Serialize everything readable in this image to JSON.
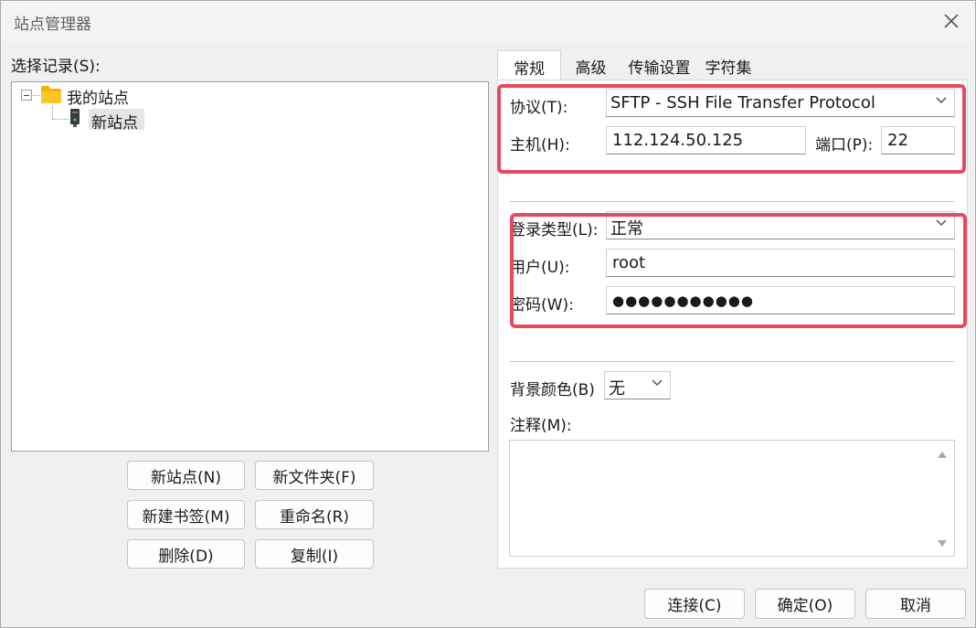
{
  "window": {
    "title": "站点管理器"
  },
  "left": {
    "records_label": "选择记录(S):",
    "tree": {
      "root": "我的站点",
      "child": "新站点"
    },
    "buttons": {
      "new_site": "新站点(N)",
      "new_folder": "新文件夹(F)",
      "new_bookmark": "新建书签(M)",
      "rename": "重命名(R)",
      "delete": "删除(D)",
      "copy": "复制(I)"
    }
  },
  "tabs": [
    "常规",
    "高级",
    "传输设置",
    "字符集"
  ],
  "general": {
    "protocol_label": "协议(T):",
    "protocol_value": "SFTP - SSH File Transfer Protocol",
    "host_label": "主机(H):",
    "host_value": "112.124.50.125",
    "port_label": "端口(P):",
    "port_value": "22",
    "logon_type_label": "登录类型(L):",
    "logon_type_value": "正常",
    "user_label": "用户(U):",
    "user_value": "root",
    "password_label": "密码(W):",
    "password_value": "●●●●●●●●●●●",
    "bg_color_label": "背景颜色(B)",
    "bg_color_value": "无",
    "comments_label": "注释(M):"
  },
  "footer": {
    "connect": "连接(C)",
    "ok": "确定(O)",
    "cancel": "取消"
  },
  "colors": {
    "highlight": "#e4495e",
    "folder": "#f5b000"
  }
}
